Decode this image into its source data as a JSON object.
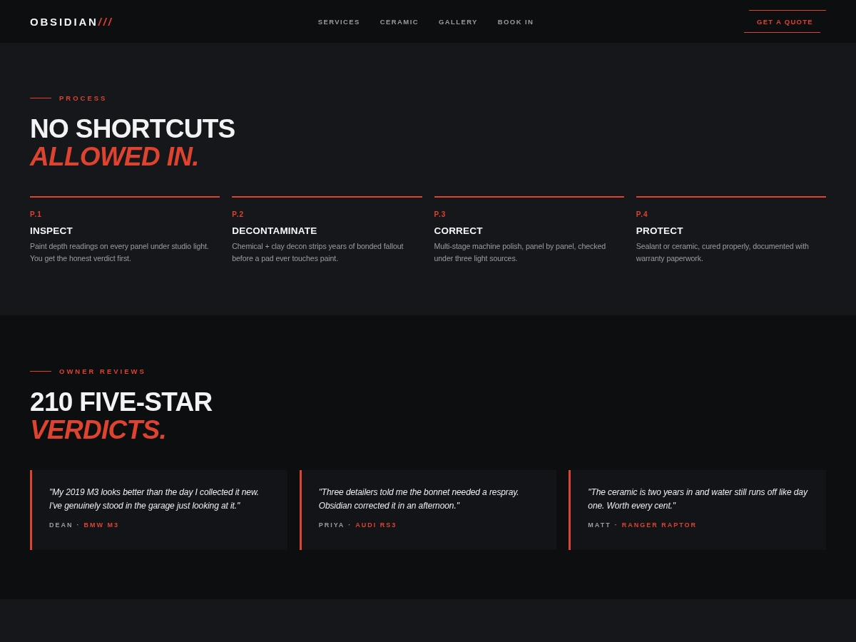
{
  "nav": {
    "brand": {
      "name": "OBSIDIAN",
      "accent": "///"
    },
    "links": [
      {
        "label": "SERVICES"
      },
      {
        "label": "CERAMIC"
      },
      {
        "label": "GALLERY"
      },
      {
        "label": "BOOK IN"
      }
    ],
    "cta": "GET A QUOTE"
  },
  "process": {
    "eyebrow": "PROCESS",
    "heading": {
      "line_1": "NO SHORTCUTS",
      "line_2": "ALLOWED IN."
    },
    "steps": [
      {
        "number": "P.1",
        "title": "INSPECT",
        "text": "Paint depth readings on every panel under studio light. You get the honest verdict first."
      },
      {
        "number": "P.2",
        "title": "DECONTAMINATE",
        "text": "Chemical + clay decon strips years of bonded fallout before a pad ever touches paint."
      },
      {
        "number": "P.3",
        "title": "CORRECT",
        "text": "Multi-stage machine polish, panel by panel, checked under three light sources."
      },
      {
        "number": "P.4",
        "title": "PROTECT",
        "text": "Sealant or ceramic, cured properly, documented with warranty paperwork."
      }
    ]
  },
  "reviews": {
    "eyebrow": "OWNER REVIEWS",
    "heading": {
      "line_1": "210 FIVE-STAR",
      "line_2": "VERDICTS."
    },
    "items": [
      {
        "quote": "\"My 2019 M3 looks better than the day I collected it new. I've genuinely stood in the garage just looking at it.\"",
        "author": "DEAN",
        "separator": "·",
        "car": "BMW M3"
      },
      {
        "quote": "\"Three detailers told me the bonnet needed a respray. Obsidian corrected it in an afternoon.\"",
        "author": "PRIYA",
        "separator": "·",
        "car": "AUDI RS3"
      },
      {
        "quote": "\"The ceramic is two years in and water still runs off like day one. Worth every cent.\"",
        "author": "MATT",
        "separator": "·",
        "car": "RANGER RAPTOR"
      }
    ]
  }
}
